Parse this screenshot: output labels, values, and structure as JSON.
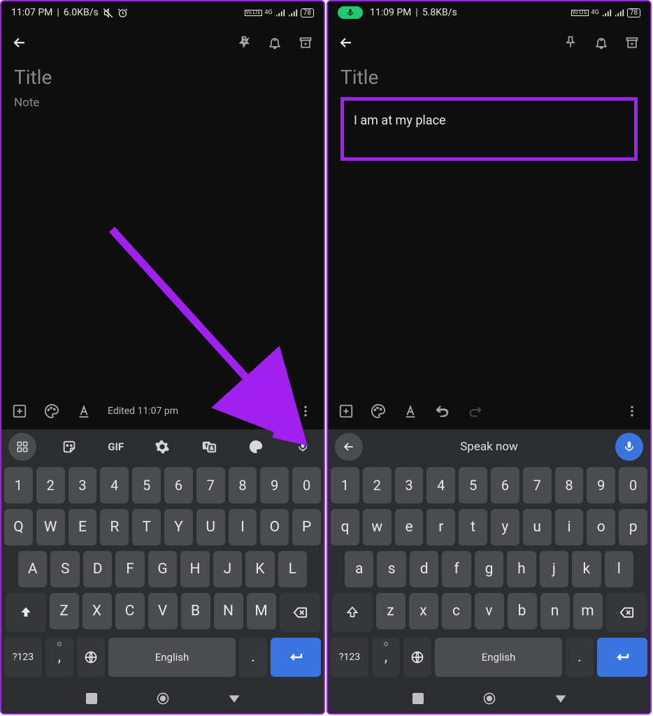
{
  "left": {
    "status": {
      "time": "11:07 PM",
      "speed": "6.0KB/s",
      "battery": "78",
      "net": "4G",
      "volte": "Vo LTE"
    },
    "toolbar": {
      "title_placeholder": "Title",
      "note_placeholder": "Note"
    },
    "bottombar": {
      "edited": "Edited 11:07 pm"
    },
    "suggest": {
      "gif": "GIF"
    },
    "keyboard": {
      "row_num": [
        "1",
        "2",
        "3",
        "4",
        "5",
        "6",
        "7",
        "8",
        "9",
        "0"
      ],
      "row1": [
        "Q",
        "W",
        "E",
        "R",
        "T",
        "Y",
        "U",
        "I",
        "O",
        "P"
      ],
      "row2": [
        "A",
        "S",
        "D",
        "F",
        "G",
        "H",
        "J",
        "K",
        "L"
      ],
      "row3": [
        "Z",
        "X",
        "C",
        "V",
        "B",
        "N",
        "M"
      ],
      "sym": "?123",
      "comma": ",",
      "lang": "English",
      "period": "."
    }
  },
  "right": {
    "status": {
      "time": "11:09 PM",
      "speed": "5.8KB/s",
      "battery": "78",
      "net": "4G",
      "volte": "Vo LTE"
    },
    "toolbar": {
      "title_placeholder": "Title"
    },
    "note_content": "I am at my place",
    "speak": {
      "label": "Speak now"
    },
    "keyboard": {
      "row_num": [
        "1",
        "2",
        "3",
        "4",
        "5",
        "6",
        "7",
        "8",
        "9",
        "0"
      ],
      "row1": [
        "q",
        "w",
        "e",
        "r",
        "t",
        "y",
        "u",
        "i",
        "o",
        "p"
      ],
      "row2": [
        "a",
        "s",
        "d",
        "f",
        "g",
        "h",
        "j",
        "k",
        "l"
      ],
      "row3": [
        "z",
        "x",
        "c",
        "v",
        "b",
        "n",
        "m"
      ],
      "sym": "?123",
      "comma": ",",
      "lang": "English",
      "period": "."
    }
  }
}
